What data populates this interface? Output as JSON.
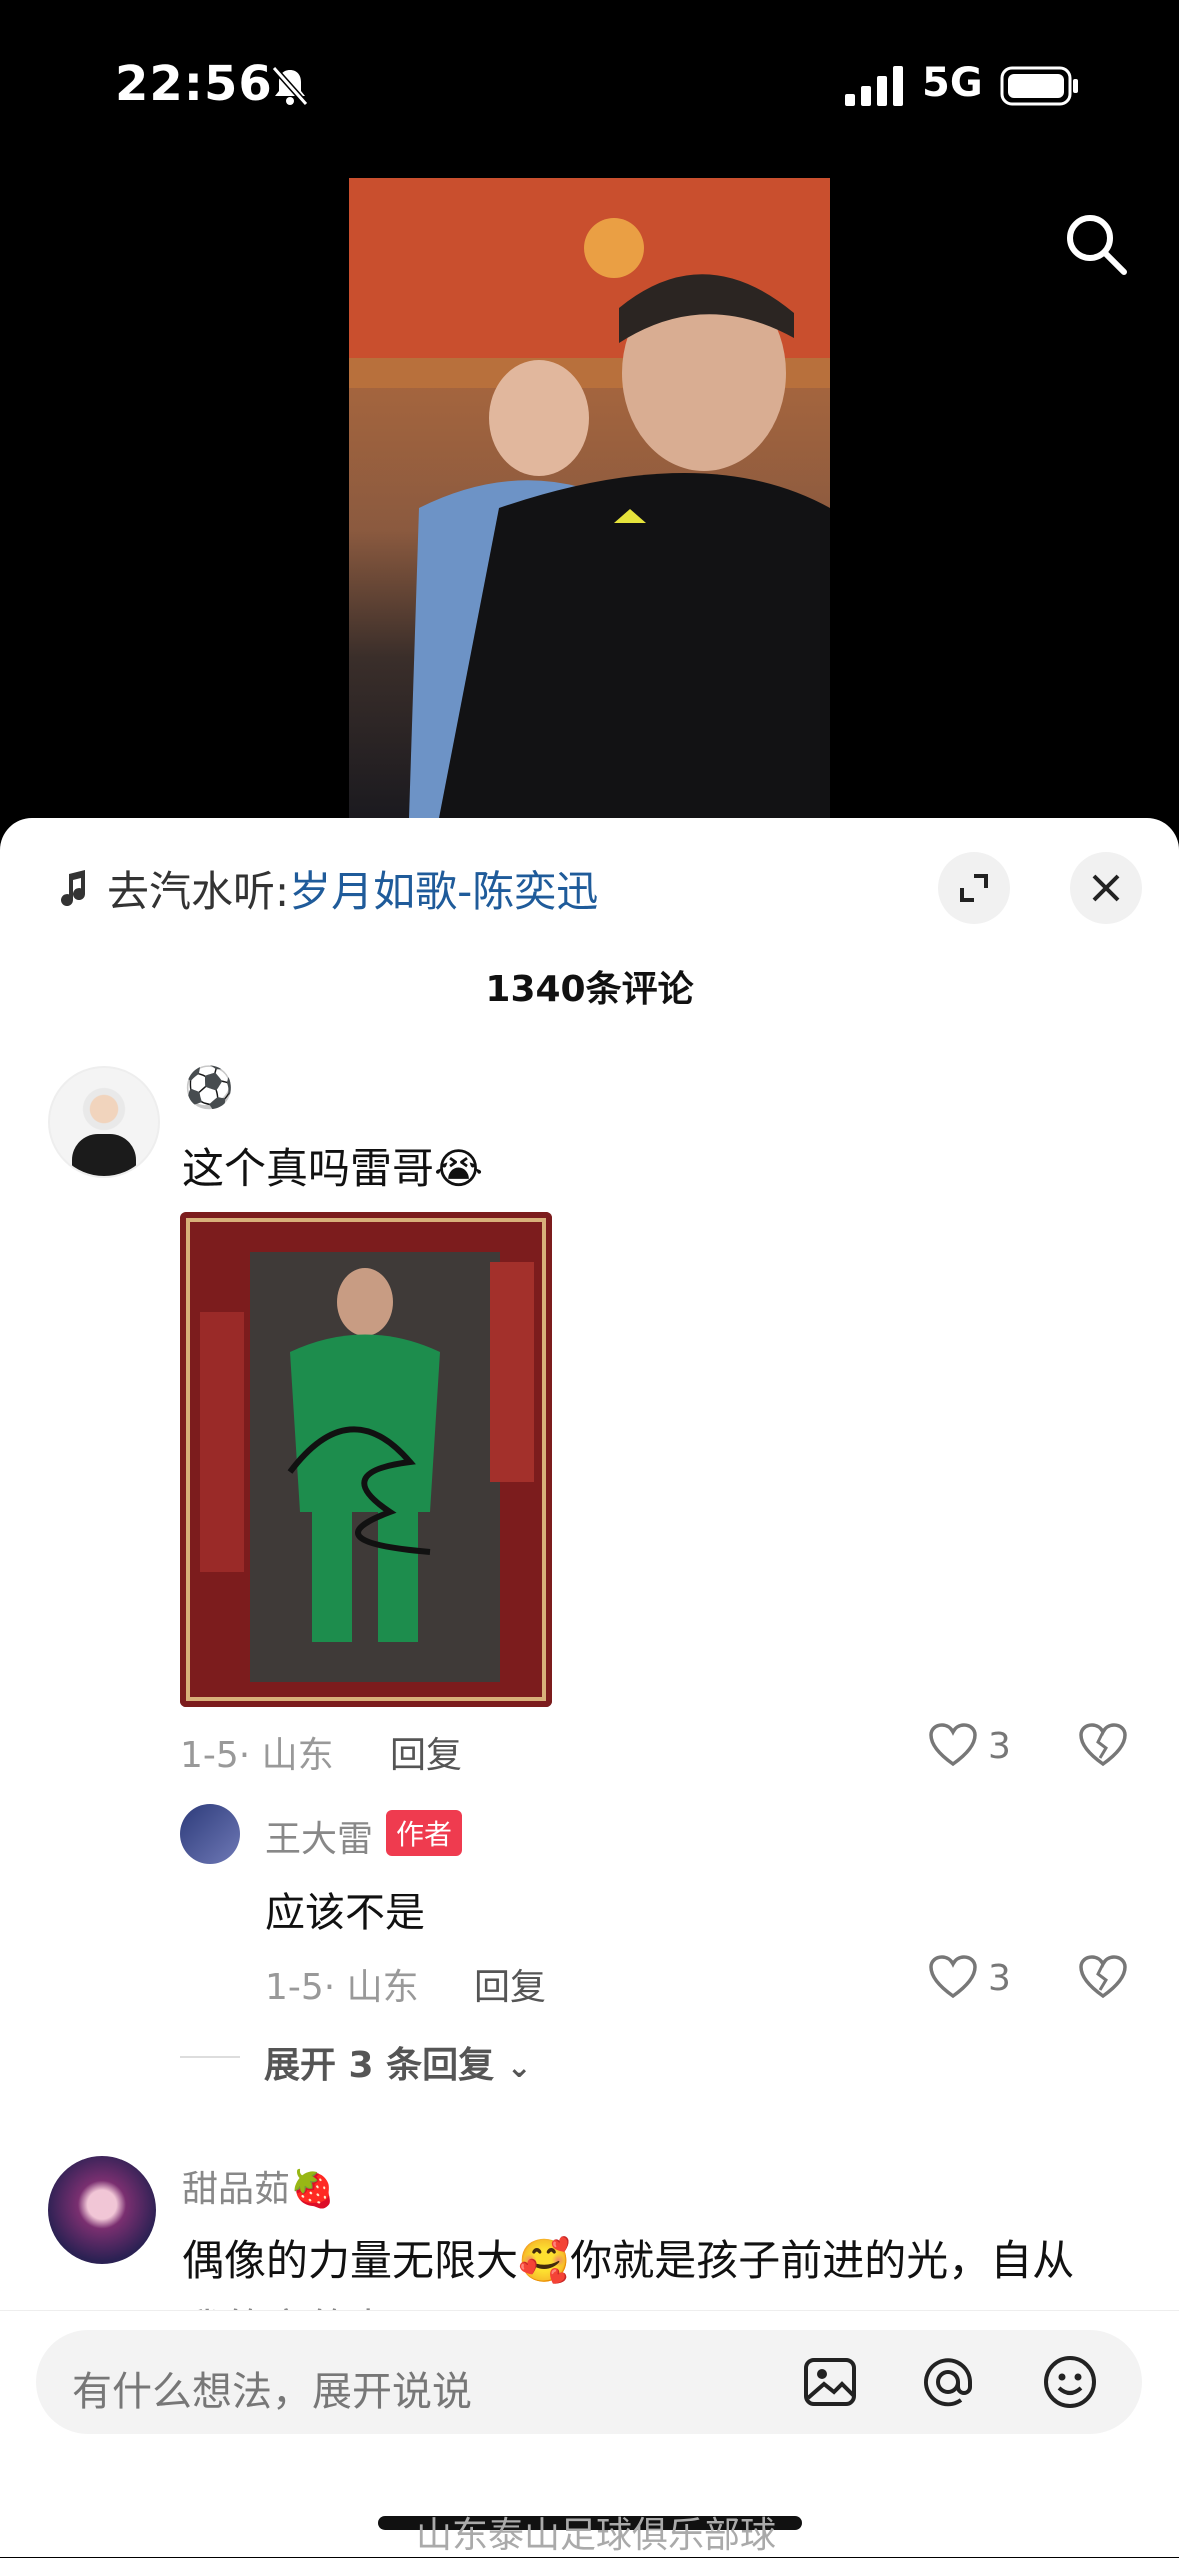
{
  "status_bar": {
    "time": "22:56",
    "network": "5G"
  },
  "sheet": {
    "music_prefix": "去汽水听: ",
    "music_song": "岁月如歌-陈奕迅",
    "comment_count": "1340条评论"
  },
  "comments": [
    {
      "name": "⚽",
      "text": "这个真吗雷哥😭",
      "meta": "1-5· 山东",
      "reply_label": "回复",
      "likes": "3",
      "replies": [
        {
          "name": "王大雷",
          "badge": "作者",
          "text": "应该不是",
          "meta": "1-5· 山东",
          "reply_label": "回复",
          "likes": "3"
        }
      ],
      "expand_label": "展开 3 条回复"
    },
    {
      "name": "甜品茹🍓",
      "text": "偶像的力量无限大🥰你就是孩子前进的光，自从",
      "text_cut": "我的宝的老…"
    }
  ],
  "input": {
    "placeholder": "有什么想法，展开说说"
  },
  "watermark": "山东泰山足球俱乐部球"
}
